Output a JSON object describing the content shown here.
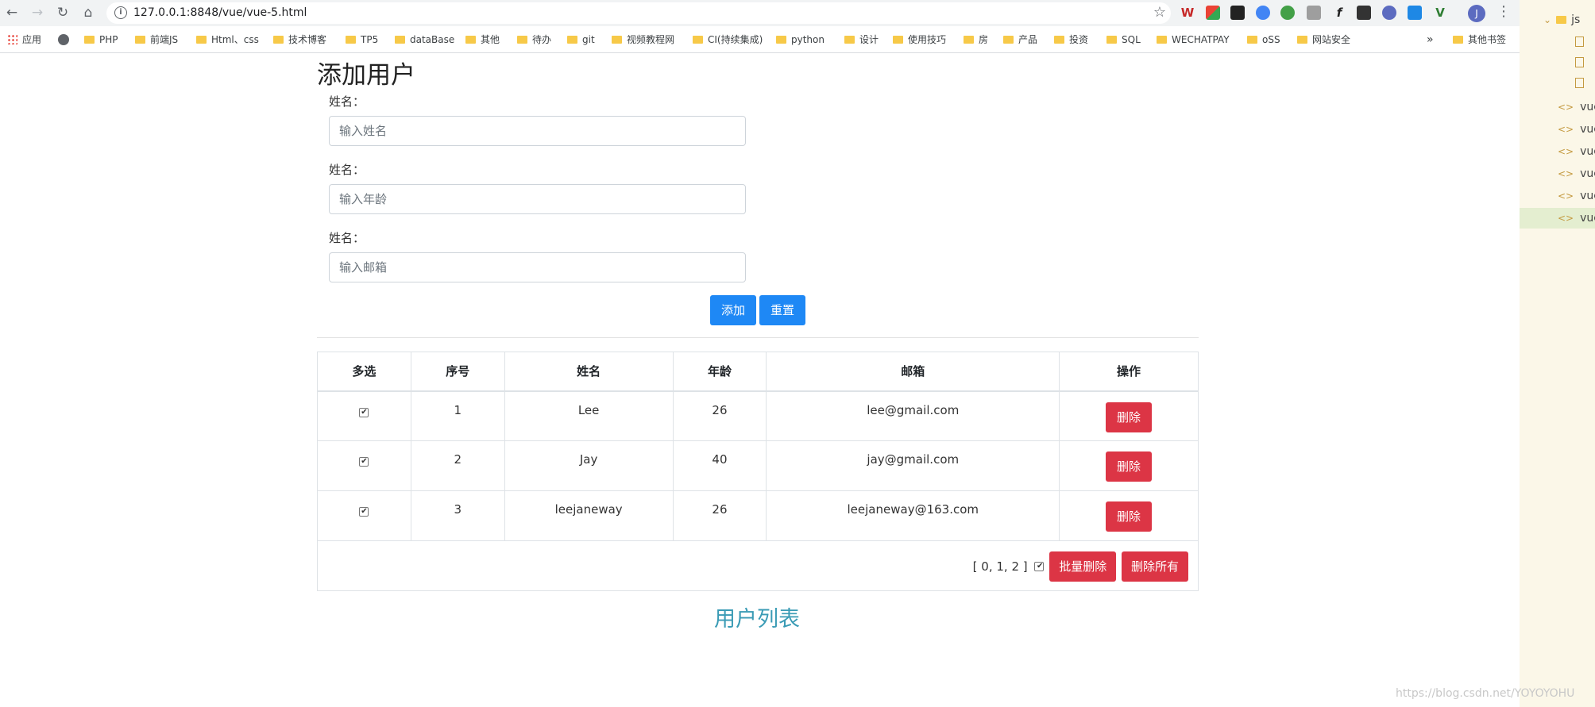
{
  "browser": {
    "url": "127.0.0.1:8848/vue/vue-5.html",
    "profile_initial": "J",
    "bookmarks": [
      "应用",
      "PHP",
      "前端JS",
      "Html、css",
      "技术博客",
      "TP5",
      "dataBase",
      "其他",
      "待办",
      "git",
      "视频教程网",
      "CI(持续集成)",
      "python",
      "设计",
      "使用技巧",
      "房",
      "产品",
      "投资",
      "SQL",
      "WECHATPAY",
      "oSS",
      "网站安全"
    ],
    "bookmarks_more": "»",
    "other_bookmarks": "其他书签"
  },
  "ide": {
    "folder": "js",
    "files": [
      "vue",
      "vue",
      "vue",
      "vue",
      "vue",
      "vue"
    ]
  },
  "form": {
    "title": "添加用户",
    "fields": [
      {
        "label": "姓名：",
        "placeholder": "输入姓名"
      },
      {
        "label": "姓名：",
        "placeholder": "输入年龄"
      },
      {
        "label": "姓名：",
        "placeholder": "输入邮箱"
      }
    ],
    "add_label": "添加",
    "reset_label": "重置"
  },
  "table": {
    "headers": [
      "多选",
      "序号",
      "姓名",
      "年龄",
      "邮箱",
      "操作"
    ],
    "rows": [
      {
        "checked": true,
        "index": "1",
        "name": "Lee",
        "age": "26",
        "email": "lee@gmail.com",
        "action": "删除"
      },
      {
        "checked": true,
        "index": "2",
        "name": "Jay",
        "age": "40",
        "email": "jay@gmail.com",
        "action": "删除"
      },
      {
        "checked": true,
        "index": "3",
        "name": "leejaneway",
        "age": "26",
        "email": "leejaneway@163.com",
        "action": "删除"
      }
    ],
    "selected_text": "[ 0, 1, 2 ]",
    "select_all_checked": true,
    "batch_delete_label": "批量删除",
    "delete_all_label": "删除所有",
    "caption": "用户列表"
  },
  "watermark": "https://blog.csdn.net/YOYOYOHU",
  "colors": {
    "primary": "#1e88f5",
    "danger": "#dc3545",
    "caption": "#3a9bb5"
  }
}
